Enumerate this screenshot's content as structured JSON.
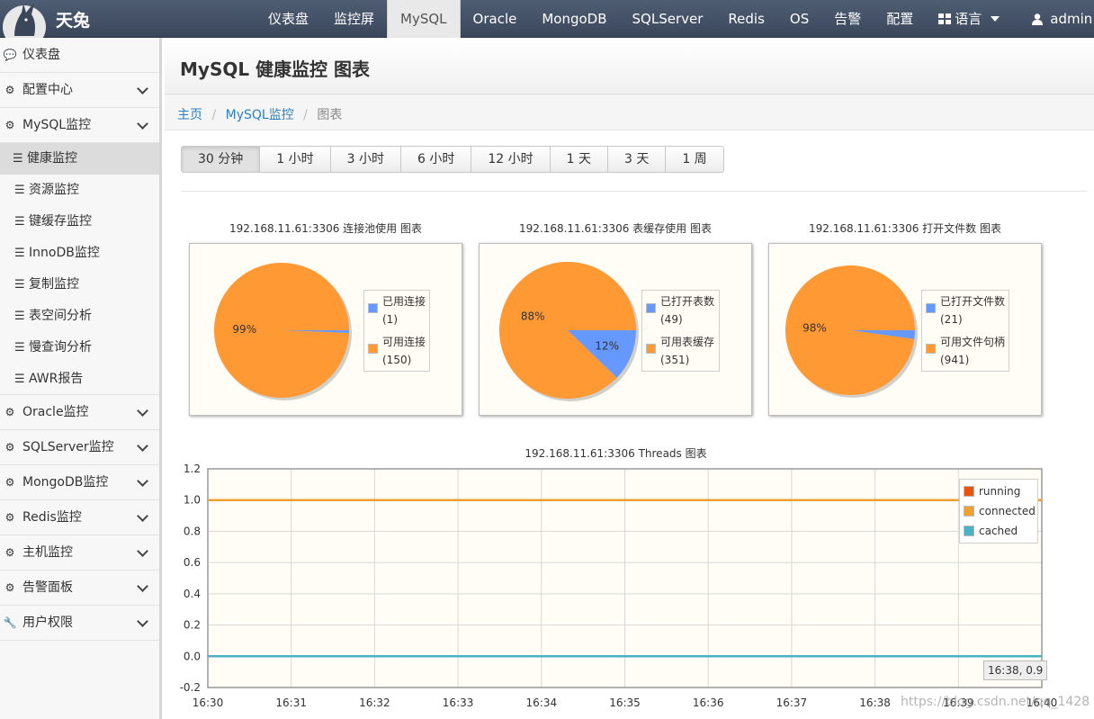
{
  "brand": {
    "name": "天兔"
  },
  "nav": {
    "items": [
      "仪表盘",
      "监控屏",
      "MySQL",
      "Oracle",
      "MongoDB",
      "SQLServer",
      "Redis",
      "OS",
      "告警",
      "配置"
    ],
    "active": "MySQL",
    "language": "语言",
    "user": "admin"
  },
  "sidebar": {
    "items": [
      {
        "label": "仪表盘",
        "icon": "comment-icon"
      },
      {
        "label": "配置中心",
        "icon": "dashboard-icon"
      },
      {
        "label": "MySQL监控",
        "icon": "dashboard-icon"
      },
      {
        "label": "Oracle监控",
        "icon": "dashboard-icon"
      },
      {
        "label": "SQLServer监控",
        "icon": "dashboard-icon"
      },
      {
        "label": "MongoDB监控",
        "icon": "dashboard-icon"
      },
      {
        "label": "Redis监控",
        "icon": "dashboard-icon"
      },
      {
        "label": "主机监控",
        "icon": "dashboard-icon"
      },
      {
        "label": "告警面板",
        "icon": "dashboard-icon"
      },
      {
        "label": "用户权限",
        "icon": "wrench-icon"
      }
    ],
    "mysql_sub": [
      "健康监控",
      "资源监控",
      "键缓存监控",
      "InnoDB监控",
      "复制监控",
      "表空间分析",
      "慢查询分析",
      "AWR报告"
    ],
    "active_sub": "健康监控"
  },
  "page": {
    "title": "MySQL 健康监控 图表"
  },
  "breadcrumb": {
    "home": "主页",
    "section": "MySQL监控",
    "current": "图表"
  },
  "ranges": {
    "items": [
      "30 分钟",
      "1 小时",
      "3 小时",
      "6 小时",
      "12 小时",
      "1 天",
      "3 天",
      "1 周"
    ],
    "active": "30 分钟"
  },
  "colors": {
    "blue": "#6699ff",
    "orange": "#ff9933",
    "running": "#e8530e",
    "connected": "#f0a030",
    "cached": "#4bb2c5"
  },
  "chart_data": [
    {
      "type": "pie",
      "title": "192.168.11.61:3306 连接池使用 图表",
      "slices": [
        {
          "label": "已用连接",
          "value": 1,
          "display": "(1)",
          "color": "#6699ff"
        },
        {
          "label": "可用连接",
          "value": 150,
          "display": "(150)",
          "color": "#ff9933",
          "pct_label": "99%"
        }
      ]
    },
    {
      "type": "pie",
      "title": "192.168.11.61:3306 表缓存使用 图表",
      "slices": [
        {
          "label": "已打开表数",
          "value": 49,
          "display": "(49)",
          "color": "#6699ff",
          "pct_label": "12%"
        },
        {
          "label": "可用表缓存",
          "value": 351,
          "display": "(351)",
          "color": "#ff9933",
          "pct_label": "88%"
        }
      ]
    },
    {
      "type": "pie",
      "title": "192.168.11.61:3306 打开文件数 图表",
      "slices": [
        {
          "label": "已打开文件数",
          "value": 21,
          "display": "(21)",
          "color": "#6699ff"
        },
        {
          "label": "可用文件句柄",
          "value": 941,
          "display": "(941)",
          "color": "#ff9933",
          "pct_label": "98%"
        }
      ]
    },
    {
      "type": "line",
      "title": "192.168.11.61:3306 Threads 图表",
      "x": [
        "16:30",
        "16:31",
        "16:32",
        "16:33",
        "16:34",
        "16:35",
        "16:36",
        "16:37",
        "16:38",
        "16:39",
        "16:40"
      ],
      "ylim": [
        -0.2,
        1.2
      ],
      "yticks": [
        "1.2",
        "1.0",
        "0.8",
        "0.6",
        "0.4",
        "0.2",
        "0.0",
        "-0.2"
      ],
      "series": [
        {
          "name": "running",
          "values": [
            0,
            0,
            0,
            0,
            0,
            0,
            0,
            0,
            0,
            0,
            0
          ],
          "color": "#e8530e"
        },
        {
          "name": "connected",
          "values": [
            1,
            1,
            1,
            1,
            1,
            1,
            1,
            1,
            1,
            1,
            1
          ],
          "color": "#f0a030"
        },
        {
          "name": "cached",
          "values": [
            0,
            0,
            0,
            0,
            0,
            0,
            0,
            0,
            0,
            0,
            0
          ],
          "color": "#4bb2c5"
        }
      ],
      "legend": "top-right",
      "grid": true,
      "tooltip": "16:38, 0.9"
    }
  ],
  "watermark": "https://blog.csdn.net/qq_1428"
}
